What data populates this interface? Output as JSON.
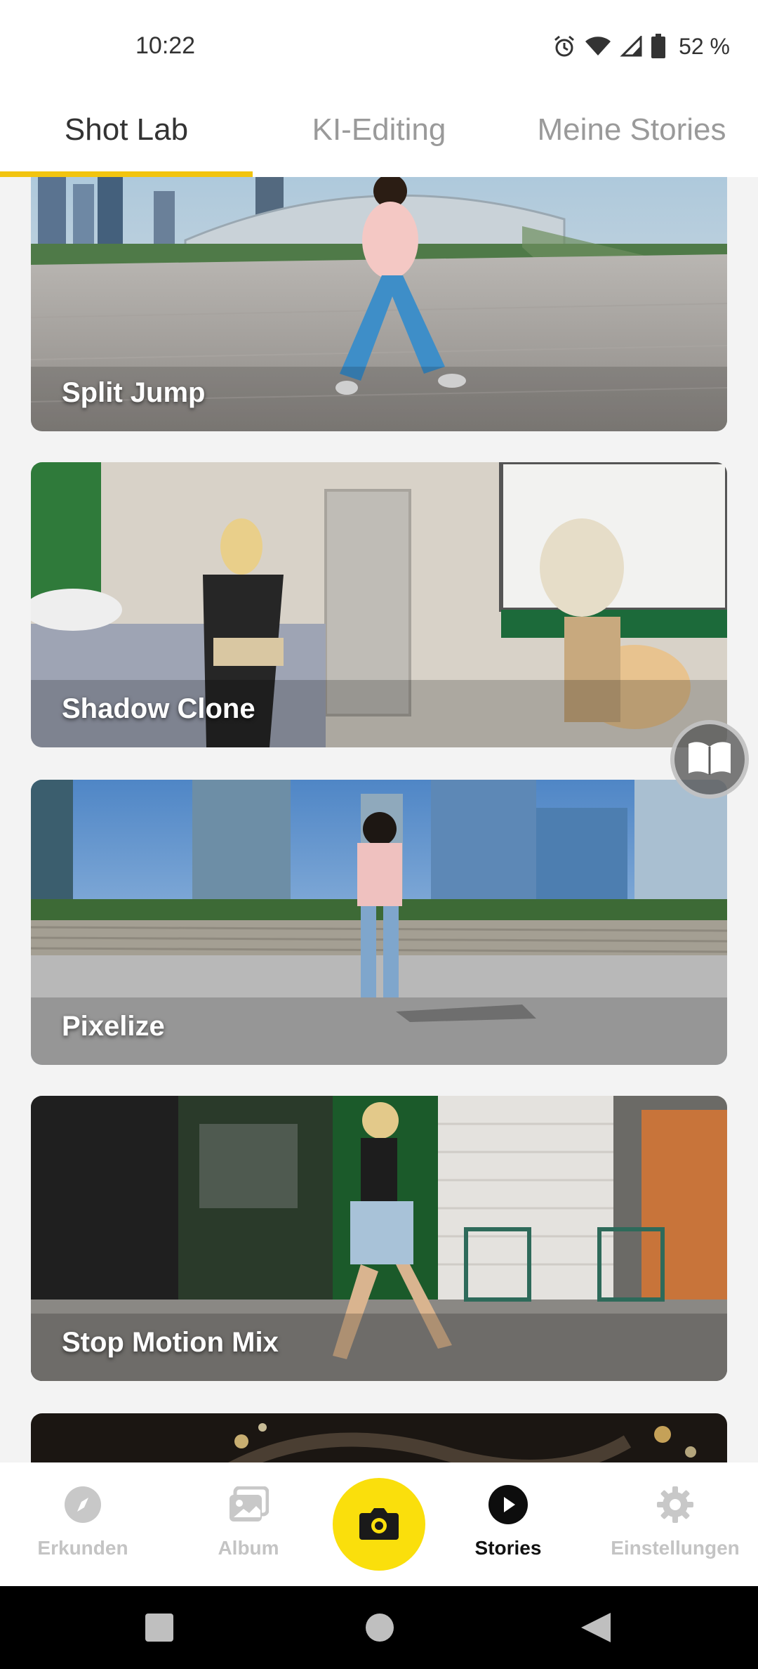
{
  "status_bar": {
    "time": "10:22",
    "battery": "52 %",
    "icons": [
      "alarm-icon",
      "wifi-icon",
      "signal-icon",
      "battery-icon"
    ]
  },
  "tabs": [
    {
      "label": "Shot Lab",
      "active": true
    },
    {
      "label": "KI-Editing",
      "active": false
    },
    {
      "label": "Meine Stories",
      "active": false
    }
  ],
  "cards": [
    {
      "label": "Split Jump"
    },
    {
      "label": "Shadow Clone"
    },
    {
      "label": "Pixelize"
    },
    {
      "label": "Stop Motion Mix"
    },
    {
      "label": ""
    }
  ],
  "guide_button": {
    "icon": "book-icon"
  },
  "bottom_nav": [
    {
      "label": "Erkunden",
      "icon": "compass-icon",
      "active": false
    },
    {
      "label": "Album",
      "icon": "album-icon",
      "active": false
    },
    {
      "label": "",
      "icon": "camera-icon",
      "active": false
    },
    {
      "label": "Stories",
      "icon": "play-icon",
      "active": true
    },
    {
      "label": "Einstellungen",
      "icon": "gear-icon",
      "active": false
    }
  ],
  "colors": {
    "accent": "#f2c40f",
    "camera": "#fadf0c"
  }
}
